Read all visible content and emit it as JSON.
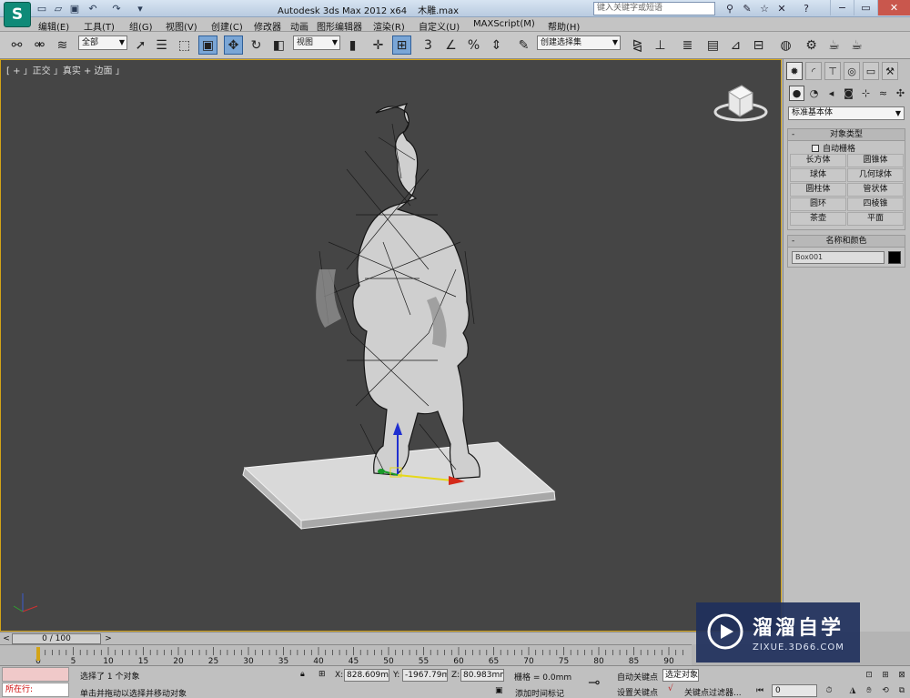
{
  "titlebar": {
    "app_logo": "S",
    "title": "Autodesk 3ds Max  2012 x64",
    "file": "木雕.max",
    "search_placeholder": "键入关键字或短语",
    "quick_access_icons": [
      "new-file-icon",
      "open-file-icon",
      "save-icon",
      "undo-icon",
      "redo-icon",
      "dropdown-arrow-icon"
    ],
    "tool_icons": [
      "binoculars-icon",
      "tools-icon",
      "star-icon",
      "close-x-icon",
      "help-icon"
    ]
  },
  "menu": {
    "items": [
      "编辑(E)",
      "工具(T)",
      "组(G)",
      "视图(V)",
      "创建(C)",
      "修改器",
      "动画",
      "图形编辑器",
      "渲染(R)",
      "自定义(U)",
      "MAXScript(M)",
      "帮助(H)"
    ]
  },
  "toolbar": {
    "selection_filter": "全部",
    "ref_coord": "视图",
    "named_selection": "创建选择集",
    "snap_label": "3",
    "percent_label": "%"
  },
  "viewport": {
    "label": "[ + ] 正交 ] 真实 + 边面 ]",
    "label_display": "[ + 」正交 」真实 + 边面 」"
  },
  "command_panel": {
    "category_dropdown": "标准基本体",
    "object_type": {
      "title": "对象类型",
      "autogrid": "自动栅格",
      "buttons": [
        "长方体",
        "圆锥体",
        "球体",
        "几何球体",
        "圆柱体",
        "管状体",
        "圆环",
        "四棱锥",
        "茶壶",
        "平面"
      ]
    },
    "name_color": {
      "title": "名称和颜色",
      "name_value": "Box001",
      "color": "#000000"
    }
  },
  "timeline": {
    "frame_display": "0 / 100",
    "ticks": [
      "0",
      "5",
      "10",
      "15",
      "20",
      "25",
      "30",
      "35",
      "40",
      "45",
      "50",
      "55",
      "60",
      "65",
      "70",
      "75",
      "80",
      "85",
      "90"
    ]
  },
  "status": {
    "selected": "选择了 1 个对象",
    "prompt": "单击并拖动以选择并移动对象",
    "running": "所在行:",
    "x_label": "X:",
    "x_value": "828.609mr",
    "y_label": "Y:",
    "y_value": "-1967.79m",
    "z_label": "Z:",
    "z_value": "80.983mm",
    "grid": "栅格 = 0.0mm",
    "add_time_tag": "添加时间标记",
    "auto_key": "自动关键点",
    "set_key": "设置关键点",
    "selection_set": "选定对象",
    "key_filters": "关键点过滤器...",
    "frame_value": "0"
  },
  "watermark": {
    "title": "溜溜自学",
    "subtitle": "ZIXUE.3D66.COM"
  }
}
